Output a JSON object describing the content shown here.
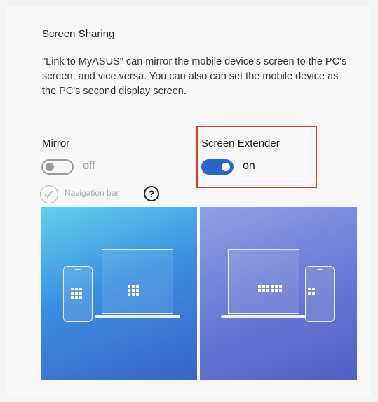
{
  "section": {
    "title": "Screen Sharing",
    "description": "\"Link to MyASUS\" can mirror the mobile device's screen to the PC's screen, and vice versa. You can also can set the mobile device as the PC's second display screen."
  },
  "mirror": {
    "label": "Mirror",
    "state": "off",
    "enabled": false,
    "nav_bar_label": "Navigation bar",
    "help_icon": "?"
  },
  "extender": {
    "label": "Screen Extender",
    "state": "on",
    "enabled": true
  },
  "colors": {
    "accent": "#2668c9",
    "highlight": "#e0392b"
  },
  "illustrations": [
    "mirror-illustration",
    "extender-illustration"
  ]
}
